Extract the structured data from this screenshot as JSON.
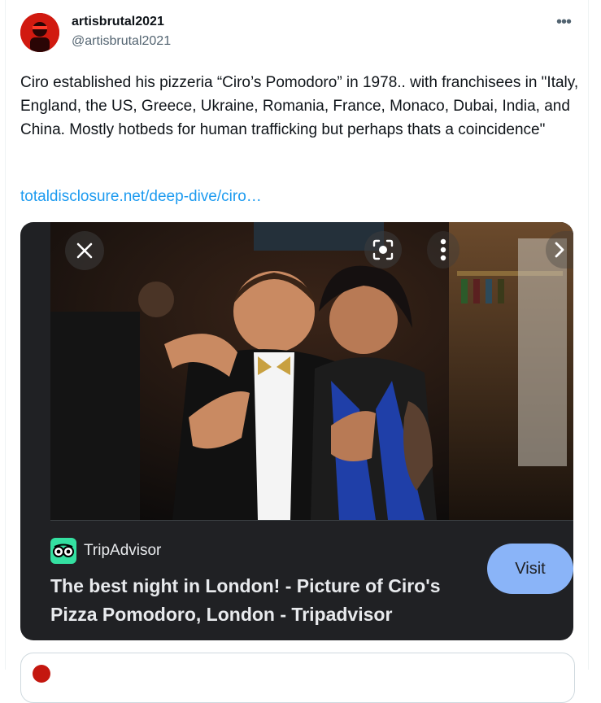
{
  "author": {
    "display_name": "artisbrutal2021",
    "handle": "@artisbrutal2021"
  },
  "more_icon": "ellipsis-icon",
  "tweet": {
    "text": "Ciro established his pizzeria “Ciro’s Pomodoro” in 1978.. with franchisees in \"Italy, England, the US, Greece, Ukraine, Romania, France, Monaco, Dubai, India, and China. Mostly hotbeds for human trafficking but perhaps thats a coincidence\"",
    "link_text": "totaldisclosure.net/deep-dive/ciro…"
  },
  "card": {
    "source": "TripAdvisor",
    "title": "The best night in London! - Picture of Ciro's Pizza Pomodoro, London - Tripadvisor",
    "visit_label": "Visit",
    "icons": [
      "close-icon",
      "lens-icon",
      "kebab-icon",
      "chevron-right-icon"
    ]
  },
  "colors": {
    "link": "#1d9bf0",
    "card_bg": "#202124",
    "visit_bg": "#8ab4f8",
    "tripadvisor_green": "#34e0a1"
  }
}
